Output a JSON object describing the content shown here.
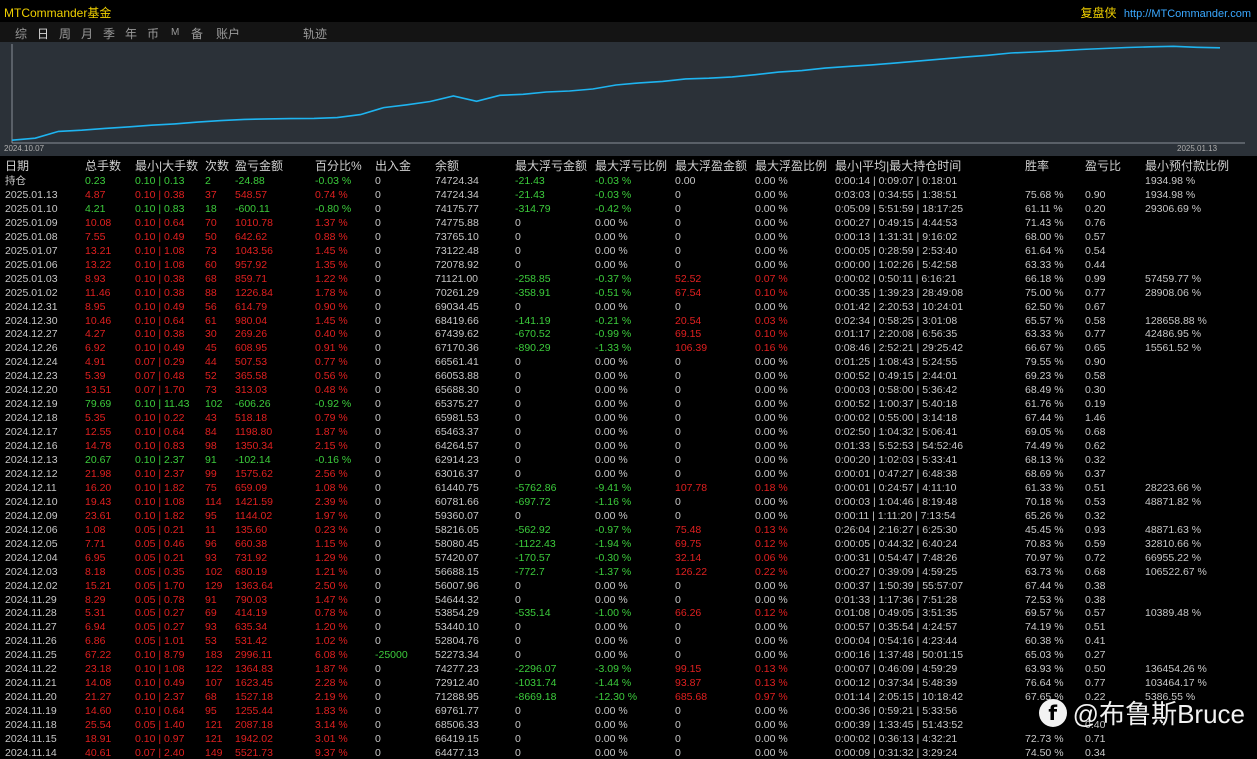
{
  "app": {
    "title": "MTCommander基金",
    "brand_name": "复盘侠",
    "brand_url": "http://MTCommander.com"
  },
  "nav": {
    "tabs": [
      "综",
      "日",
      "周",
      "月",
      "季",
      "年",
      "币",
      "M",
      "备",
      "账户",
      "轨迹"
    ],
    "active": "日"
  },
  "chart_data": {
    "type": "line",
    "x_start_label": "2024.10.07",
    "x_end_label": "2025.01.13",
    "ylim": [
      37000,
      76000
    ],
    "series": [
      {
        "values": [
          37700,
          38500,
          41200,
          41700,
          42400,
          43000,
          43700,
          44200,
          44900,
          45500,
          46000,
          46200,
          46300,
          46400,
          46700,
          47900,
          50700,
          51800,
          53100,
          55300,
          53200,
          55600,
          56000,
          56900,
          57300,
          58100,
          59700,
          60500,
          61100,
          62100,
          62400,
          62900,
          63800,
          64800,
          65400,
          66400,
          67100,
          67700,
          68400,
          69200,
          70000,
          70800,
          71500,
          72400,
          72800,
          73300,
          73800,
          74200,
          74600,
          74900,
          75100,
          74700,
          74500
        ]
      }
    ]
  },
  "table": {
    "headers": [
      "日期",
      "总手数",
      "最小|大手数",
      "次数",
      "盈亏金额",
      "百分比%",
      "出入金",
      "余额",
      "最大浮亏金额",
      "最大浮亏比例",
      "最大浮盈金额",
      "最大浮盈比例",
      "最小|平均|最大持仓时间",
      "胜率",
      "盈亏比",
      "最小预付款比例"
    ],
    "rows": [
      {
        "s": "pos",
        "c": [
          "持仓",
          "0.23",
          "0.10 | 0.13",
          "2",
          "-24.88",
          "-0.03 %",
          "0",
          "74724.34",
          "-21.43",
          "-0.03 %",
          "0.00",
          "0.00 %",
          "0:00:14 | 0:09:07 | 0:18:01",
          "",
          "",
          "1934.98 %"
        ]
      },
      {
        "s": "neg",
        "c": [
          "2025.01.13",
          "4.87",
          "0.10 | 0.38",
          "37",
          "548.57",
          "0.74 %",
          "0",
          "74724.34",
          "-21.43",
          "-0.03 %",
          "0",
          "0.00 %",
          "0:03:03 | 0:34:55 | 1:38:51",
          "75.68 %",
          "0.90",
          "1934.98 %"
        ]
      },
      {
        "s": "pos",
        "c": [
          "2025.01.10",
          "4.21",
          "0.10 | 0.83",
          "18",
          "-600.11",
          "-0.80 %",
          "0",
          "74175.77",
          "-314.79",
          "-0.42 %",
          "0",
          "0.00 %",
          "0:05:09 | 5:51:59 | 18:17:25",
          "61.11 %",
          "0.20",
          "29306.69 %"
        ]
      },
      {
        "s": "neg",
        "c": [
          "2025.01.09",
          "10.08",
          "0.10 | 0.64",
          "70",
          "1010.78",
          "1.37 %",
          "0",
          "74775.88",
          "0",
          "0.00 %",
          "0",
          "0.00 %",
          "0:00:27 | 0:49:15 | 4:44:53",
          "71.43 %",
          "0.76",
          ""
        ]
      },
      {
        "s": "neg",
        "c": [
          "2025.01.08",
          "7.55",
          "0.10 | 0.49",
          "50",
          "642.62",
          "0.88 %",
          "0",
          "73765.10",
          "0",
          "0.00 %",
          "0",
          "0.00 %",
          "0:00:13 | 1:31:31 | 9:16:02",
          "68.00 %",
          "0.57",
          ""
        ]
      },
      {
        "s": "neg",
        "c": [
          "2025.01.07",
          "13.21",
          "0.10 | 1.08",
          "73",
          "1043.56",
          "1.45 %",
          "0",
          "73122.48",
          "0",
          "0.00 %",
          "0",
          "0.00 %",
          "0:00:05 | 0:28:59 | 2:53:40",
          "61.64 %",
          "0.54",
          ""
        ]
      },
      {
        "s": "neg",
        "c": [
          "2025.01.06",
          "13.22",
          "0.10 | 1.08",
          "60",
          "957.92",
          "1.35 %",
          "0",
          "72078.92",
          "0",
          "0.00 %",
          "0",
          "0.00 %",
          "0:00:00 | 1:02:26 | 5:42:58",
          "63.33 %",
          "0.44",
          ""
        ]
      },
      {
        "s": "neg",
        "c": [
          "2025.01.03",
          "8.93",
          "0.10 | 0.38",
          "68",
          "859.71",
          "1.22 %",
          "0",
          "71121.00",
          "-258.85",
          "-0.37 %",
          "52.52",
          "0.07 %",
          "0:00:02 | 0:50:11 | 6:16:21",
          "66.18 %",
          "0.99",
          "57459.77 %"
        ]
      },
      {
        "s": "neg",
        "c": [
          "2025.01.02",
          "11.46",
          "0.10 | 0.38",
          "88",
          "1226.84",
          "1.78 %",
          "0",
          "70261.29",
          "-358.91",
          "-0.51 %",
          "67.54",
          "0.10 %",
          "0:00:35 | 1:39:23 | 28:49:08",
          "75.00 %",
          "0.77",
          "28908.06 %"
        ]
      },
      {
        "s": "neg",
        "c": [
          "2024.12.31",
          "8.95",
          "0.10 | 0.49",
          "56",
          "614.79",
          "0.90 %",
          "0",
          "69034.45",
          "0",
          "0.00 %",
          "0",
          "0.00 %",
          "0:01:42 | 2:20:53 | 10:24:01",
          "62.50 %",
          "0.67",
          ""
        ]
      },
      {
        "s": "neg",
        "c": [
          "2024.12.30",
          "10.46",
          "0.10 | 0.64",
          "61",
          "980.04",
          "1.45 %",
          "0",
          "68419.66",
          "-141.19",
          "-0.21 %",
          "20.54",
          "0.03 %",
          "0:02:34 | 0:58:25 | 3:01:08",
          "65.57 %",
          "0.58",
          "128658.88 %"
        ]
      },
      {
        "s": "neg",
        "c": [
          "2024.12.27",
          "4.27",
          "0.10 | 0.38",
          "30",
          "269.26",
          "0.40 %",
          "0",
          "67439.62",
          "-670.52",
          "-0.99 %",
          "69.15",
          "0.10 %",
          "0:01:17 | 2:20:08 | 6:56:35",
          "63.33 %",
          "0.77",
          "42486.95 %"
        ]
      },
      {
        "s": "neg",
        "c": [
          "2024.12.26",
          "6.92",
          "0.10 | 0.49",
          "45",
          "608.95",
          "0.91 %",
          "0",
          "67170.36",
          "-890.29",
          "-1.33 %",
          "106.39",
          "0.16 %",
          "0:08:46 | 2:52:21 | 29:25:42",
          "66.67 %",
          "0.65",
          "15561.52 %"
        ]
      },
      {
        "s": "neg",
        "c": [
          "2024.12.24",
          "4.91",
          "0.07 | 0.29",
          "44",
          "507.53",
          "0.77 %",
          "0",
          "66561.41",
          "0",
          "0.00 %",
          "0",
          "0.00 %",
          "0:01:25 | 1:08:43 | 5:24:55",
          "79.55 %",
          "0.90",
          ""
        ]
      },
      {
        "s": "neg",
        "c": [
          "2024.12.23",
          "5.39",
          "0.07 | 0.48",
          "52",
          "365.58",
          "0.56 %",
          "0",
          "66053.88",
          "0",
          "0.00 %",
          "0",
          "0.00 %",
          "0:00:52 | 0:49:15 | 2:44:01",
          "69.23 %",
          "0.58",
          ""
        ]
      },
      {
        "s": "neg",
        "c": [
          "2024.12.20",
          "13.51",
          "0.07 | 1.70",
          "73",
          "313.03",
          "0.48 %",
          "0",
          "65688.30",
          "0",
          "0.00 %",
          "0",
          "0.00 %",
          "0:00:03 | 0:58:00 | 5:36:42",
          "68.49 %",
          "0.30",
          ""
        ]
      },
      {
        "s": "pos",
        "c": [
          "2024.12.19",
          "79.69",
          "0.10 | 11.43",
          "102",
          "-606.26",
          "-0.92 %",
          "0",
          "65375.27",
          "0",
          "0.00 %",
          "0",
          "0.00 %",
          "0:00:52 | 1:00:37 | 5:40:18",
          "61.76 %",
          "0.19",
          ""
        ]
      },
      {
        "s": "neg",
        "c": [
          "2024.12.18",
          "5.35",
          "0.10 | 0.22",
          "43",
          "518.18",
          "0.79 %",
          "0",
          "65981.53",
          "0",
          "0.00 %",
          "0",
          "0.00 %",
          "0:00:02 | 0:55:00 | 3:14:18",
          "67.44 %",
          "1.46",
          ""
        ]
      },
      {
        "s": "neg",
        "c": [
          "2024.12.17",
          "12.55",
          "0.10 | 0.64",
          "84",
          "1198.80",
          "1.87 %",
          "0",
          "65463.37",
          "0",
          "0.00 %",
          "0",
          "0.00 %",
          "0:02:50 | 1:04:32 | 5:06:41",
          "69.05 %",
          "0.68",
          ""
        ]
      },
      {
        "s": "neg",
        "c": [
          "2024.12.16",
          "14.78",
          "0.10 | 0.83",
          "98",
          "1350.34",
          "2.15 %",
          "0",
          "64264.57",
          "0",
          "0.00 %",
          "0",
          "0.00 %",
          "0:01:33 | 5:52:53 | 54:52:46",
          "74.49 %",
          "0.62",
          ""
        ]
      },
      {
        "s": "pos",
        "c": [
          "2024.12.13",
          "20.67",
          "0.10 | 2.37",
          "91",
          "-102.14",
          "-0.16 %",
          "0",
          "62914.23",
          "0",
          "0.00 %",
          "0",
          "0.00 %",
          "0:00:20 | 1:02:03 | 5:33:41",
          "68.13 %",
          "0.32",
          ""
        ]
      },
      {
        "s": "neg",
        "c": [
          "2024.12.12",
          "21.98",
          "0.10 | 2.37",
          "99",
          "1575.62",
          "2.56 %",
          "0",
          "63016.37",
          "0",
          "0.00 %",
          "0",
          "0.00 %",
          "0:00:01 | 0:47:27 | 6:48:38",
          "68.69 %",
          "0.37",
          ""
        ]
      },
      {
        "s": "neg",
        "c": [
          "2024.12.11",
          "16.20",
          "0.10 | 1.82",
          "75",
          "659.09",
          "1.08 %",
          "0",
          "61440.75",
          "-5762.86",
          "-9.41 %",
          "107.78",
          "0.18 %",
          "0:00:01 | 0:24:57 | 4:11:10",
          "61.33 %",
          "0.51",
          "28223.66 %"
        ]
      },
      {
        "s": "neg",
        "c": [
          "2024.12.10",
          "19.43",
          "0.10 | 1.08",
          "114",
          "1421.59",
          "2.39 %",
          "0",
          "60781.66",
          "-697.72",
          "-1.16 %",
          "0",
          "0.00 %",
          "0:00:03 | 1:04:46 | 8:19:48",
          "70.18 %",
          "0.53",
          "48871.82 %"
        ]
      },
      {
        "s": "neg",
        "c": [
          "2024.12.09",
          "23.61",
          "0.10 | 1.82",
          "95",
          "1144.02",
          "1.97 %",
          "0",
          "59360.07",
          "0",
          "0.00 %",
          "0",
          "0.00 %",
          "0:00:11 | 1:11:20 | 7:13:54",
          "65.26 %",
          "0.32",
          ""
        ]
      },
      {
        "s": "neg",
        "c": [
          "2024.12.06",
          "1.08",
          "0.05 | 0.21",
          "11",
          "135.60",
          "0.23 %",
          "0",
          "58216.05",
          "-562.92",
          "-0.97 %",
          "75.48",
          "0.13 %",
          "0:26:04 | 2:16:27 | 6:25:30",
          "45.45 %",
          "0.93",
          "48871.63 %"
        ]
      },
      {
        "s": "neg",
        "c": [
          "2024.12.05",
          "7.71",
          "0.05 | 0.46",
          "96",
          "660.38",
          "1.15 %",
          "0",
          "58080.45",
          "-1122.43",
          "-1.94 %",
          "69.75",
          "0.12 %",
          "0:00:05 | 0:44:32 | 6:40:24",
          "70.83 %",
          "0.59",
          "32810.66 %"
        ]
      },
      {
        "s": "neg",
        "c": [
          "2024.12.04",
          "6.95",
          "0.05 | 0.21",
          "93",
          "731.92",
          "1.29 %",
          "0",
          "57420.07",
          "-170.57",
          "-0.30 %",
          "32.14",
          "0.06 %",
          "0:00:31 | 0:54:47 | 7:48:26",
          "70.97 %",
          "0.72",
          "66955.22 %"
        ]
      },
      {
        "s": "neg",
        "c": [
          "2024.12.03",
          "8.18",
          "0.05 | 0.35",
          "102",
          "680.19",
          "1.21 %",
          "0",
          "56688.15",
          "-772.7",
          "-1.37 %",
          "126.22",
          "0.22 %",
          "0:00:27 | 0:39:09 | 4:59:25",
          "63.73 %",
          "0.68",
          "106522.67 %"
        ]
      },
      {
        "s": "neg",
        "c": [
          "2024.12.02",
          "15.21",
          "0.05 | 1.70",
          "129",
          "1363.64",
          "2.50 %",
          "0",
          "56007.96",
          "0",
          "0.00 %",
          "0",
          "0.00 %",
          "0:00:37 | 1:50:39 | 55:57:07",
          "67.44 %",
          "0.38",
          ""
        ]
      },
      {
        "s": "neg",
        "c": [
          "2024.11.29",
          "8.29",
          "0.05 | 0.78",
          "91",
          "790.03",
          "1.47 %",
          "0",
          "54644.32",
          "0",
          "0.00 %",
          "0",
          "0.00 %",
          "0:01:33 | 1:17:36 | 7:51:28",
          "72.53 %",
          "0.38",
          ""
        ]
      },
      {
        "s": "neg",
        "c": [
          "2024.11.28",
          "5.31",
          "0.05 | 0.27",
          "69",
          "414.19",
          "0.78 %",
          "0",
          "53854.29",
          "-535.14",
          "-1.00 %",
          "66.26",
          "0.12 %",
          "0:01:08 | 0:49:05 | 3:51:35",
          "69.57 %",
          "0.57",
          "10389.48 %"
        ]
      },
      {
        "s": "neg",
        "c": [
          "2024.11.27",
          "6.94",
          "0.05 | 0.27",
          "93",
          "635.34",
          "1.20 %",
          "0",
          "53440.10",
          "0",
          "0.00 %",
          "0",
          "0.00 %",
          "0:00:57 | 0:35:54 | 4:24:57",
          "74.19 %",
          "0.51",
          ""
        ]
      },
      {
        "s": "neg",
        "c": [
          "2024.11.26",
          "6.86",
          "0.05 | 1.01",
          "53",
          "531.42",
          "1.02 %",
          "0",
          "52804.76",
          "0",
          "0.00 %",
          "0",
          "0.00 %",
          "0:00:04 | 0:54:16 | 4:23:44",
          "60.38 %",
          "0.41",
          ""
        ]
      },
      {
        "s": "neg",
        "c": [
          "2024.11.25",
          "67.22",
          "0.10 | 8.79",
          "183",
          "2996.11",
          "6.08 %",
          "-25000",
          "52273.34",
          "0",
          "0.00 %",
          "0",
          "0.00 %",
          "0:00:16 | 1:37:48 | 50:01:15",
          "65.03 %",
          "0.27",
          ""
        ]
      },
      {
        "s": "neg",
        "c": [
          "2024.11.22",
          "23.18",
          "0.10 | 1.08",
          "122",
          "1364.83",
          "1.87 %",
          "0",
          "74277.23",
          "-2296.07",
          "-3.09 %",
          "99.15",
          "0.13 %",
          "0:00:07 | 0:46:09 | 4:59:29",
          "63.93 %",
          "0.50",
          "136454.26 %"
        ]
      },
      {
        "s": "neg",
        "c": [
          "2024.11.21",
          "14.08",
          "0.10 | 0.49",
          "107",
          "1623.45",
          "2.28 %",
          "0",
          "72912.40",
          "-1031.74",
          "-1.44 %",
          "93.87",
          "0.13 %",
          "0:00:12 | 0:37:34 | 5:48:39",
          "76.64 %",
          "0.77",
          "103464.17 %"
        ]
      },
      {
        "s": "neg",
        "c": [
          "2024.11.20",
          "21.27",
          "0.10 | 2.37",
          "68",
          "1527.18",
          "2.19 %",
          "0",
          "71288.95",
          "-8669.18",
          "-12.30 %",
          "685.68",
          "0.97 %",
          "0:01:14 | 2:05:15 | 10:18:42",
          "67.65 %",
          "0.22",
          "5386.55 %"
        ]
      },
      {
        "s": "neg",
        "c": [
          "2024.11.19",
          "14.60",
          "0.10 | 0.64",
          "95",
          "1255.44",
          "1.83 %",
          "0",
          "69761.77",
          "0",
          "0.00 %",
          "0",
          "0.00 %",
          "0:00:36 | 0:59:21 | 5:33:56",
          "",
          "",
          ""
        ]
      },
      {
        "s": "neg",
        "c": [
          "2024.11.18",
          "25.54",
          "0.05 | 1.40",
          "121",
          "2087.18",
          "3.14 %",
          "0",
          "68506.33",
          "0",
          "0.00 %",
          "0",
          "0.00 %",
          "0:00:39 | 1:33:45 | 51:43:52",
          "",
          "0.40",
          ""
        ]
      },
      {
        "s": "neg",
        "c": [
          "2024.11.15",
          "18.91",
          "0.10 | 0.97",
          "121",
          "1942.02",
          "3.01 %",
          "0",
          "66419.15",
          "0",
          "0.00 %",
          "0",
          "0.00 %",
          "0:00:02 | 0:36:13 | 4:32:21",
          "72.73 %",
          "0.71",
          ""
        ]
      },
      {
        "s": "neg",
        "c": [
          "2024.11.14",
          "40.61",
          "0.07 | 2.40",
          "149",
          "5521.73",
          "9.37 %",
          "0",
          "64477.13",
          "0",
          "0.00 %",
          "0",
          "0.00 %",
          "0:00:09 | 0:31:32 | 3:29:24",
          "74.50 %",
          "0.34",
          ""
        ]
      }
    ]
  },
  "watermark": {
    "logo_letter": "f",
    "text": "@布鲁斯Bruce"
  }
}
